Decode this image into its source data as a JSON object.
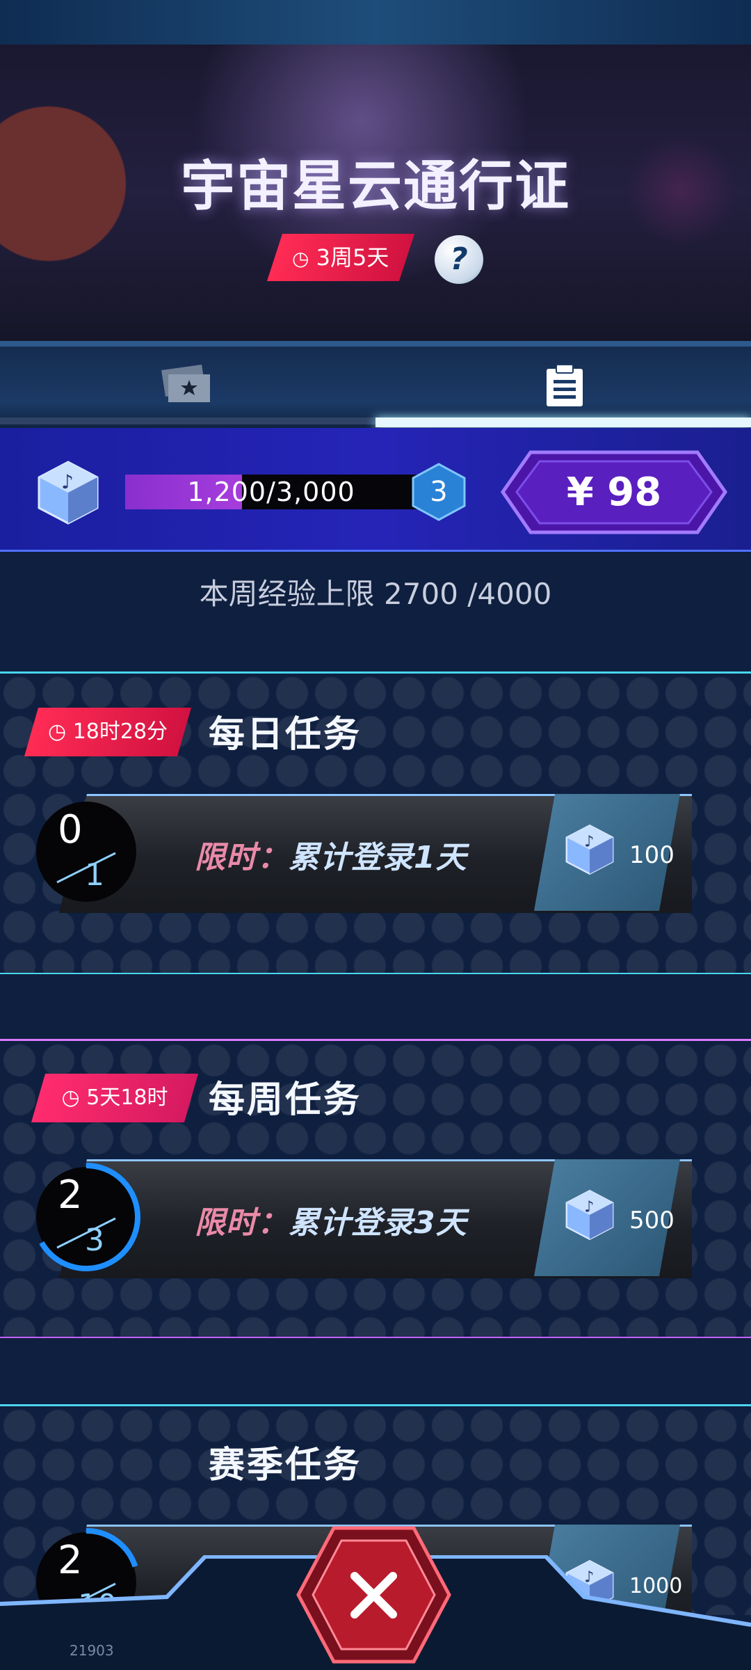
{
  "header": {
    "title": "宇宙星云通行证",
    "timer": "3周5天",
    "help_label": "?"
  },
  "tabs": [
    {
      "name": "rewards",
      "icon": "ticket-star-icon",
      "active": false
    },
    {
      "name": "tasks",
      "icon": "clipboard-icon",
      "active": true
    }
  ],
  "level": {
    "xp_text": "1,200/3,000",
    "xp_current": 1200,
    "xp_max": 3000,
    "level": "3",
    "price": "¥ 98"
  },
  "weekly_limit_text": "本周经验上限 2700 /4000",
  "sections": {
    "daily": {
      "title": "每日任务",
      "timer": "18时28分",
      "task": {
        "prefix": "限时：",
        "text": "累计登录1天",
        "progress_num": "0",
        "progress_den": "1",
        "progress": 0,
        "reward": "100"
      }
    },
    "weekly": {
      "title": "每周任务",
      "timer": "5天18时",
      "task": {
        "prefix": "限时：",
        "text": "累计登录3天",
        "progress_num": "2",
        "progress_den": "3",
        "progress": 0.6667,
        "reward": "500"
      }
    },
    "season": {
      "title": "赛季任务",
      "task": {
        "progress_num": "2",
        "progress_den": "10",
        "progress": 0.2,
        "reward": "1000"
      }
    }
  },
  "close_label": "×",
  "build_number": "21903",
  "colors": {
    "accent_pink": "#ff2c55",
    "accent_blue": "#1f8fff",
    "xp_purple": "#a53ddc"
  }
}
